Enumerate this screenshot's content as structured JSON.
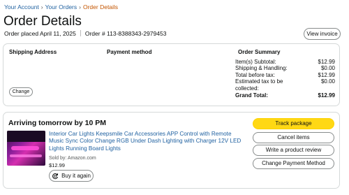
{
  "breadcrumb": {
    "items": [
      "Your Account",
      "Your Orders"
    ],
    "current": "Order Details",
    "separator": "›"
  },
  "page": {
    "title": "Order Details",
    "order_placed": "Order placed April 11, 2025",
    "order_number": "Order # 113-8388343-2979453",
    "view_invoice": "View invoice"
  },
  "details": {
    "shipping_header": "Shipping Address",
    "payment_header": "Payment method",
    "change_button": "Change",
    "summary_header": "Order Summary",
    "summary_rows": [
      {
        "label": "Item(s) Subtotal:",
        "value": "$12.99"
      },
      {
        "label": "Shipping & Handling:",
        "value": "$0.00"
      },
      {
        "label": "Total before tax:",
        "value": "$12.99"
      },
      {
        "label": "Estimated tax to be collected:",
        "value": "$0.00"
      }
    ],
    "grand_total": {
      "label": "Grand Total:",
      "value": "$12.99"
    }
  },
  "shipment": {
    "arrival": "Arriving tomorrow by 10 PM",
    "product_title": "Interior Car Lights Keepsmile Car Accessories APP Control with Remote Music Sync Color Change RGB Under Dash Lighting with Charger 12V LED Lights Running Board Lights",
    "sold_by": "Sold by: Amazon.com",
    "price": "$12.99",
    "buy_again": "Buy it again",
    "actions": {
      "track": "Track package",
      "cancel": "Cancel items",
      "review": "Write a product review",
      "payment": "Change Payment Method"
    }
  },
  "colors": {
    "link": "#2162a1",
    "breadcrumb_current": "#c45500",
    "primary_button": "#ffd814",
    "border": "#d5d9d9"
  },
  "icons": {
    "buy_again": "reorder-cycle-icon"
  }
}
